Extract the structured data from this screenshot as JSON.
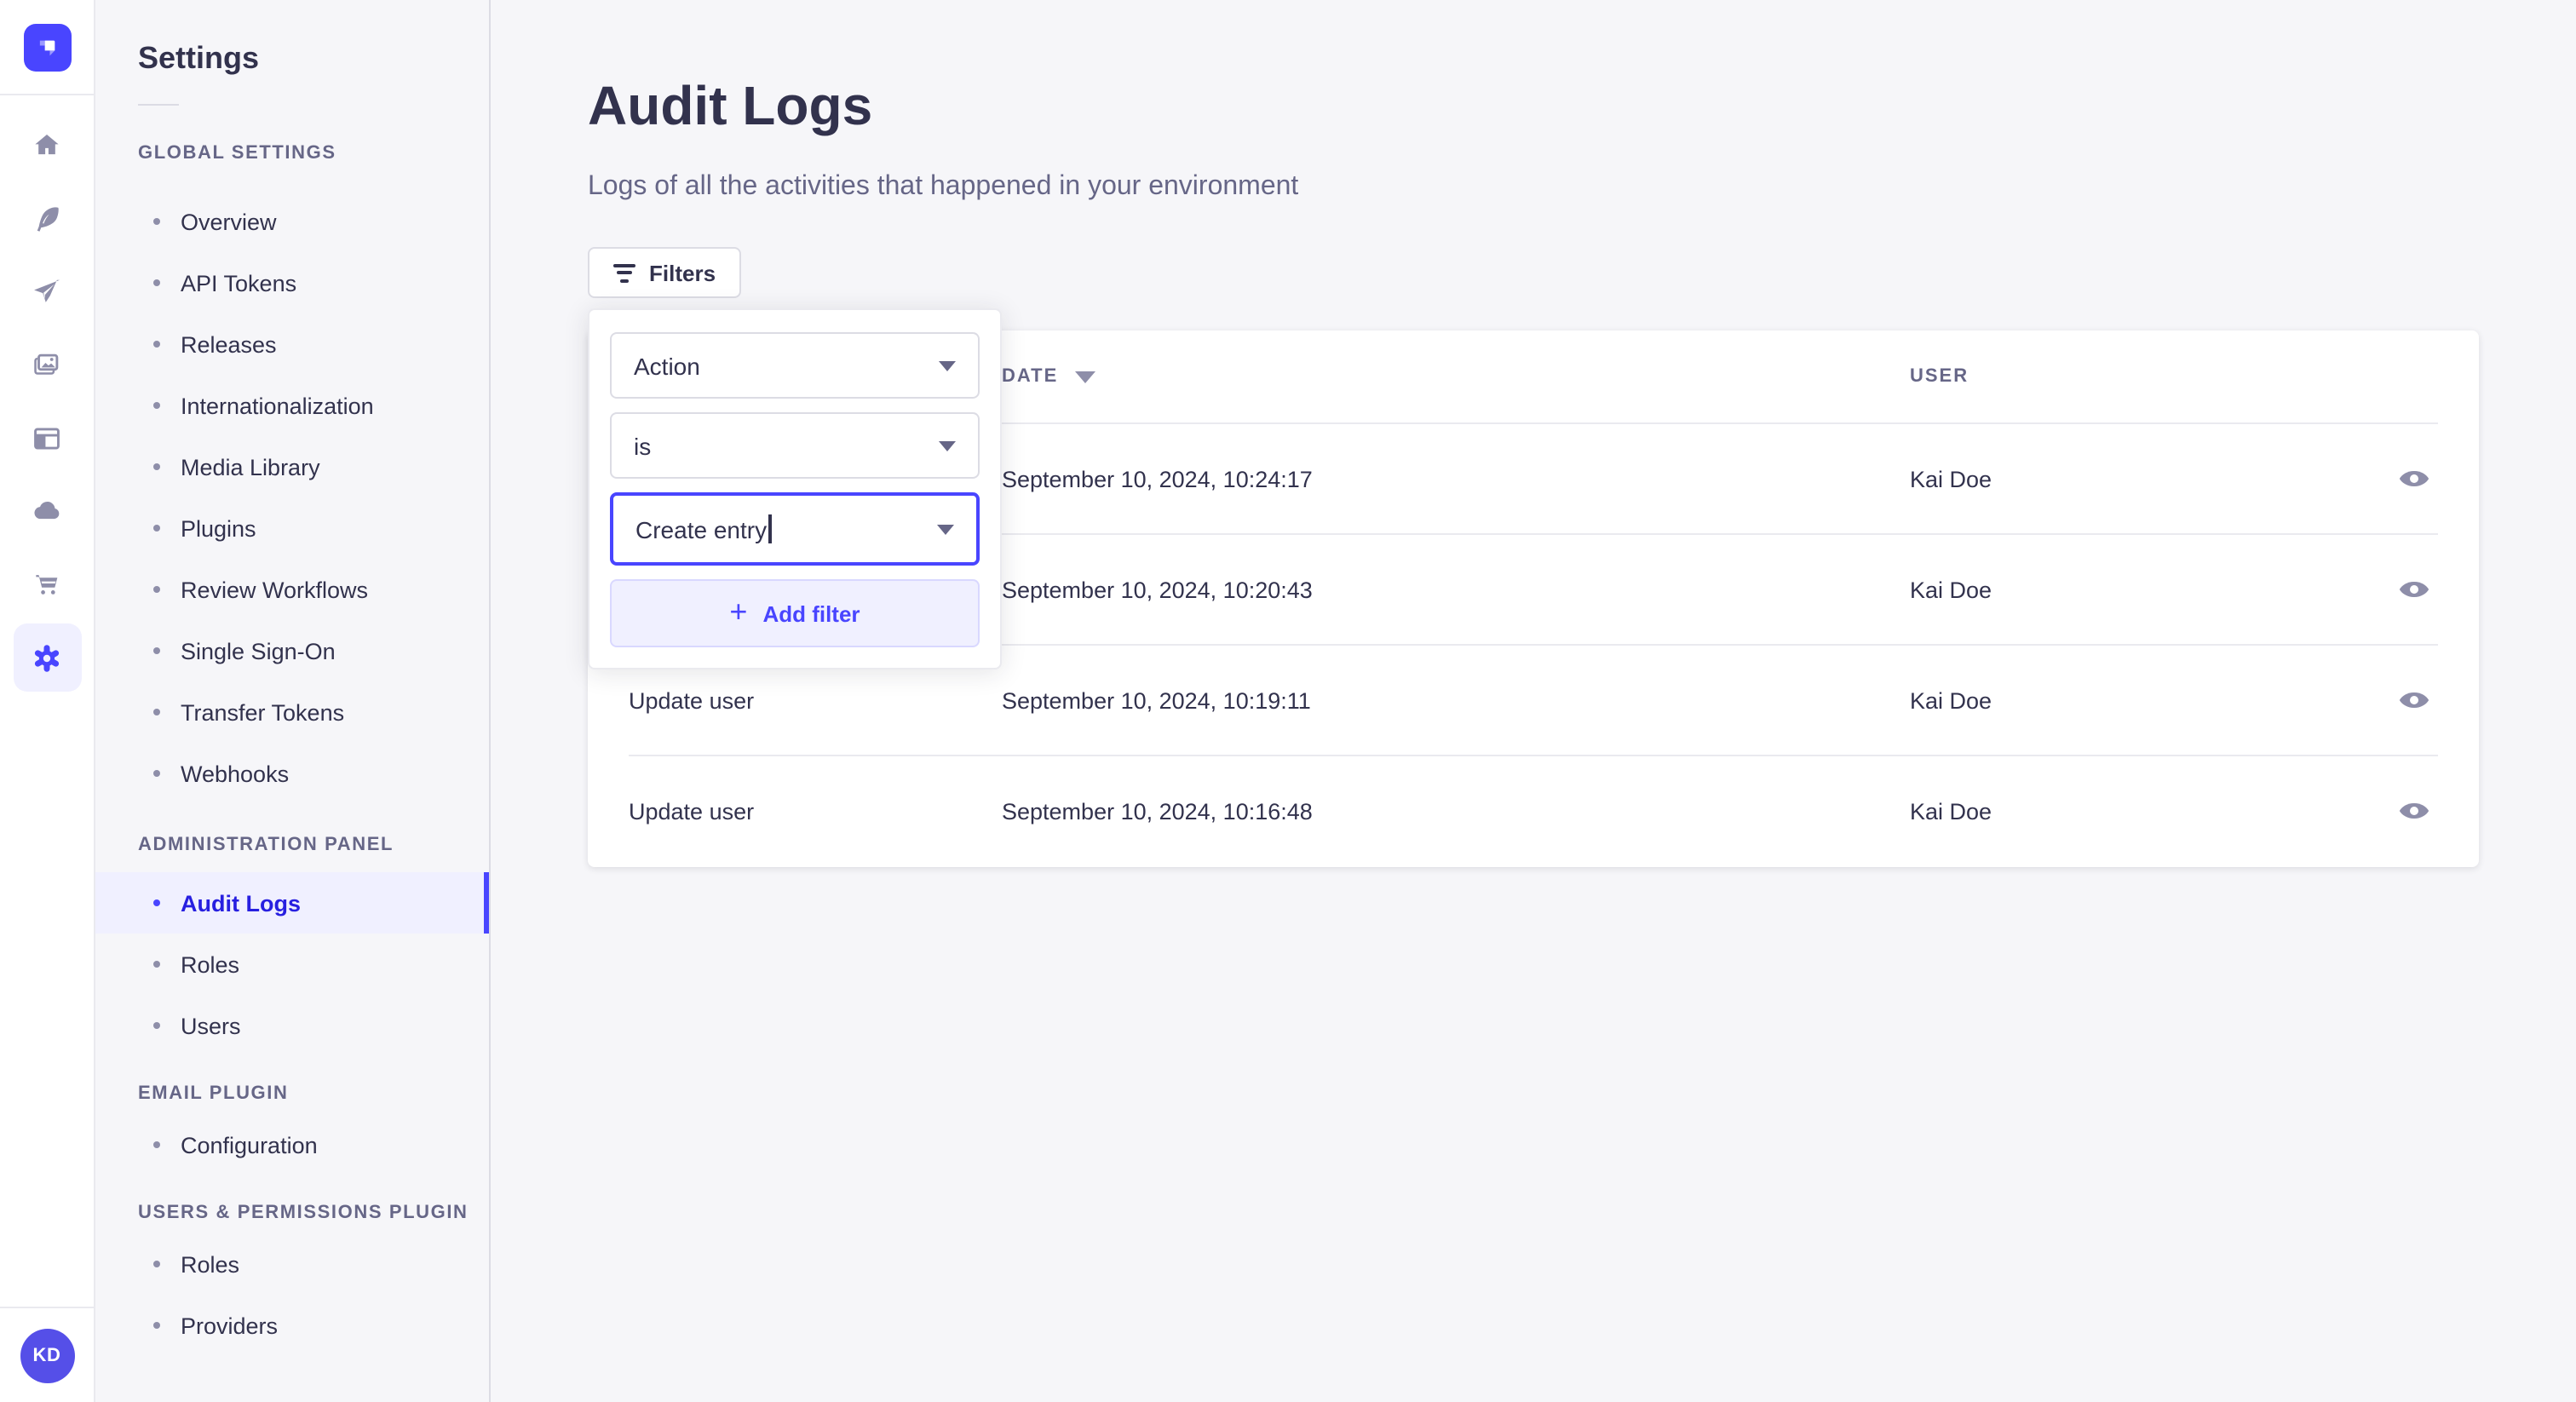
{
  "app_title": "Settings",
  "colors": {
    "accent": "#4945FF",
    "accent_light": "#F0F0FF",
    "text": "#32324D",
    "text_muted": "#666687",
    "icon_muted": "#8E8EA9",
    "bg": "#F6F6F9"
  },
  "icon_nav": {
    "logo_icon": "strapi-logo-icon",
    "items": [
      {
        "icon": "home-icon",
        "active": false
      },
      {
        "icon": "feather-icon",
        "active": false
      },
      {
        "icon": "paper-plane-icon",
        "active": false
      },
      {
        "icon": "media-library-icon",
        "active": false
      },
      {
        "icon": "layout-icon",
        "active": false
      },
      {
        "icon": "cloud-icon",
        "active": false
      },
      {
        "icon": "cart-icon",
        "active": false
      },
      {
        "icon": "gear-icon",
        "active": true
      }
    ],
    "avatar_initials": "KD"
  },
  "sidebar": {
    "title": "Settings",
    "sections": [
      {
        "label": "GLOBAL SETTINGS",
        "items": [
          {
            "label": "Overview",
            "active": false
          },
          {
            "label": "API Tokens",
            "active": false
          },
          {
            "label": "Releases",
            "active": false
          },
          {
            "label": "Internationalization",
            "active": false
          },
          {
            "label": "Media Library",
            "active": false
          },
          {
            "label": "Plugins",
            "active": false
          },
          {
            "label": "Review Workflows",
            "active": false
          },
          {
            "label": "Single Sign-On",
            "active": false
          },
          {
            "label": "Transfer Tokens",
            "active": false
          },
          {
            "label": "Webhooks",
            "active": false
          }
        ]
      },
      {
        "label": "ADMINISTRATION PANEL",
        "items": [
          {
            "label": "Audit Logs",
            "active": true
          },
          {
            "label": "Roles",
            "active": false
          },
          {
            "label": "Users",
            "active": false
          }
        ]
      },
      {
        "label": "EMAIL PLUGIN",
        "items": [
          {
            "label": "Configuration",
            "active": false
          }
        ]
      },
      {
        "label": "USERS & PERMISSIONS PLUGIN",
        "items": [
          {
            "label": "Roles",
            "active": false
          },
          {
            "label": "Providers",
            "active": false
          }
        ]
      }
    ]
  },
  "page": {
    "title": "Audit Logs",
    "subtitle": "Logs of all the activities that happened in your environment"
  },
  "filters": {
    "button_label": "Filters",
    "popover": {
      "field_value": "Action",
      "operator_value": "is",
      "value_input": "Create entry",
      "add_filter_label": "Add filter"
    }
  },
  "table": {
    "headers": {
      "date": "DATE",
      "user": "USER"
    },
    "sorted_by": "date",
    "rows": [
      {
        "action": "",
        "date": "September 10, 2024, 10:24:17",
        "user": "Kai Doe"
      },
      {
        "action": "",
        "date": "September 10, 2024, 10:20:43",
        "user": "Kai Doe"
      },
      {
        "action": "Update user",
        "date": "September 10, 2024, 10:19:11",
        "user": "Kai Doe"
      },
      {
        "action": "Update user",
        "date": "September 10, 2024, 10:16:48",
        "user": "Kai Doe"
      }
    ]
  }
}
